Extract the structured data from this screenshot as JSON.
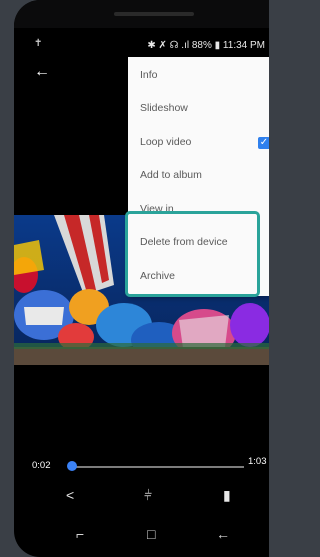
{
  "status": {
    "left_icon": "accessibility-icon",
    "right_text": "✱ ✗ ☊ .ıl 88% ▮ 11:34 PM"
  },
  "menu": {
    "items": [
      {
        "label": "Info"
      },
      {
        "label": "Slideshow"
      },
      {
        "label": "Loop video",
        "checked": true
      },
      {
        "label": "Add to album"
      },
      {
        "label": "View in"
      },
      {
        "label": "Delete from device"
      },
      {
        "label": "Archive"
      }
    ],
    "highlight_color": "#2aa39a",
    "accent_color": "#2f80ed"
  },
  "player": {
    "current_time": "0:02",
    "total_time": "1:03",
    "progress": 0.03
  },
  "actions": [
    {
      "name": "share-icon",
      "glyph": "<"
    },
    {
      "name": "edit-sliders-icon",
      "glyph": "⫩"
    },
    {
      "name": "trash-icon",
      "glyph": "▮"
    }
  ],
  "nav": [
    {
      "name": "recent-apps-icon",
      "glyph": "⌐"
    },
    {
      "name": "home-icon",
      "glyph": "□"
    },
    {
      "name": "back-nav-icon",
      "glyph": "←"
    }
  ]
}
